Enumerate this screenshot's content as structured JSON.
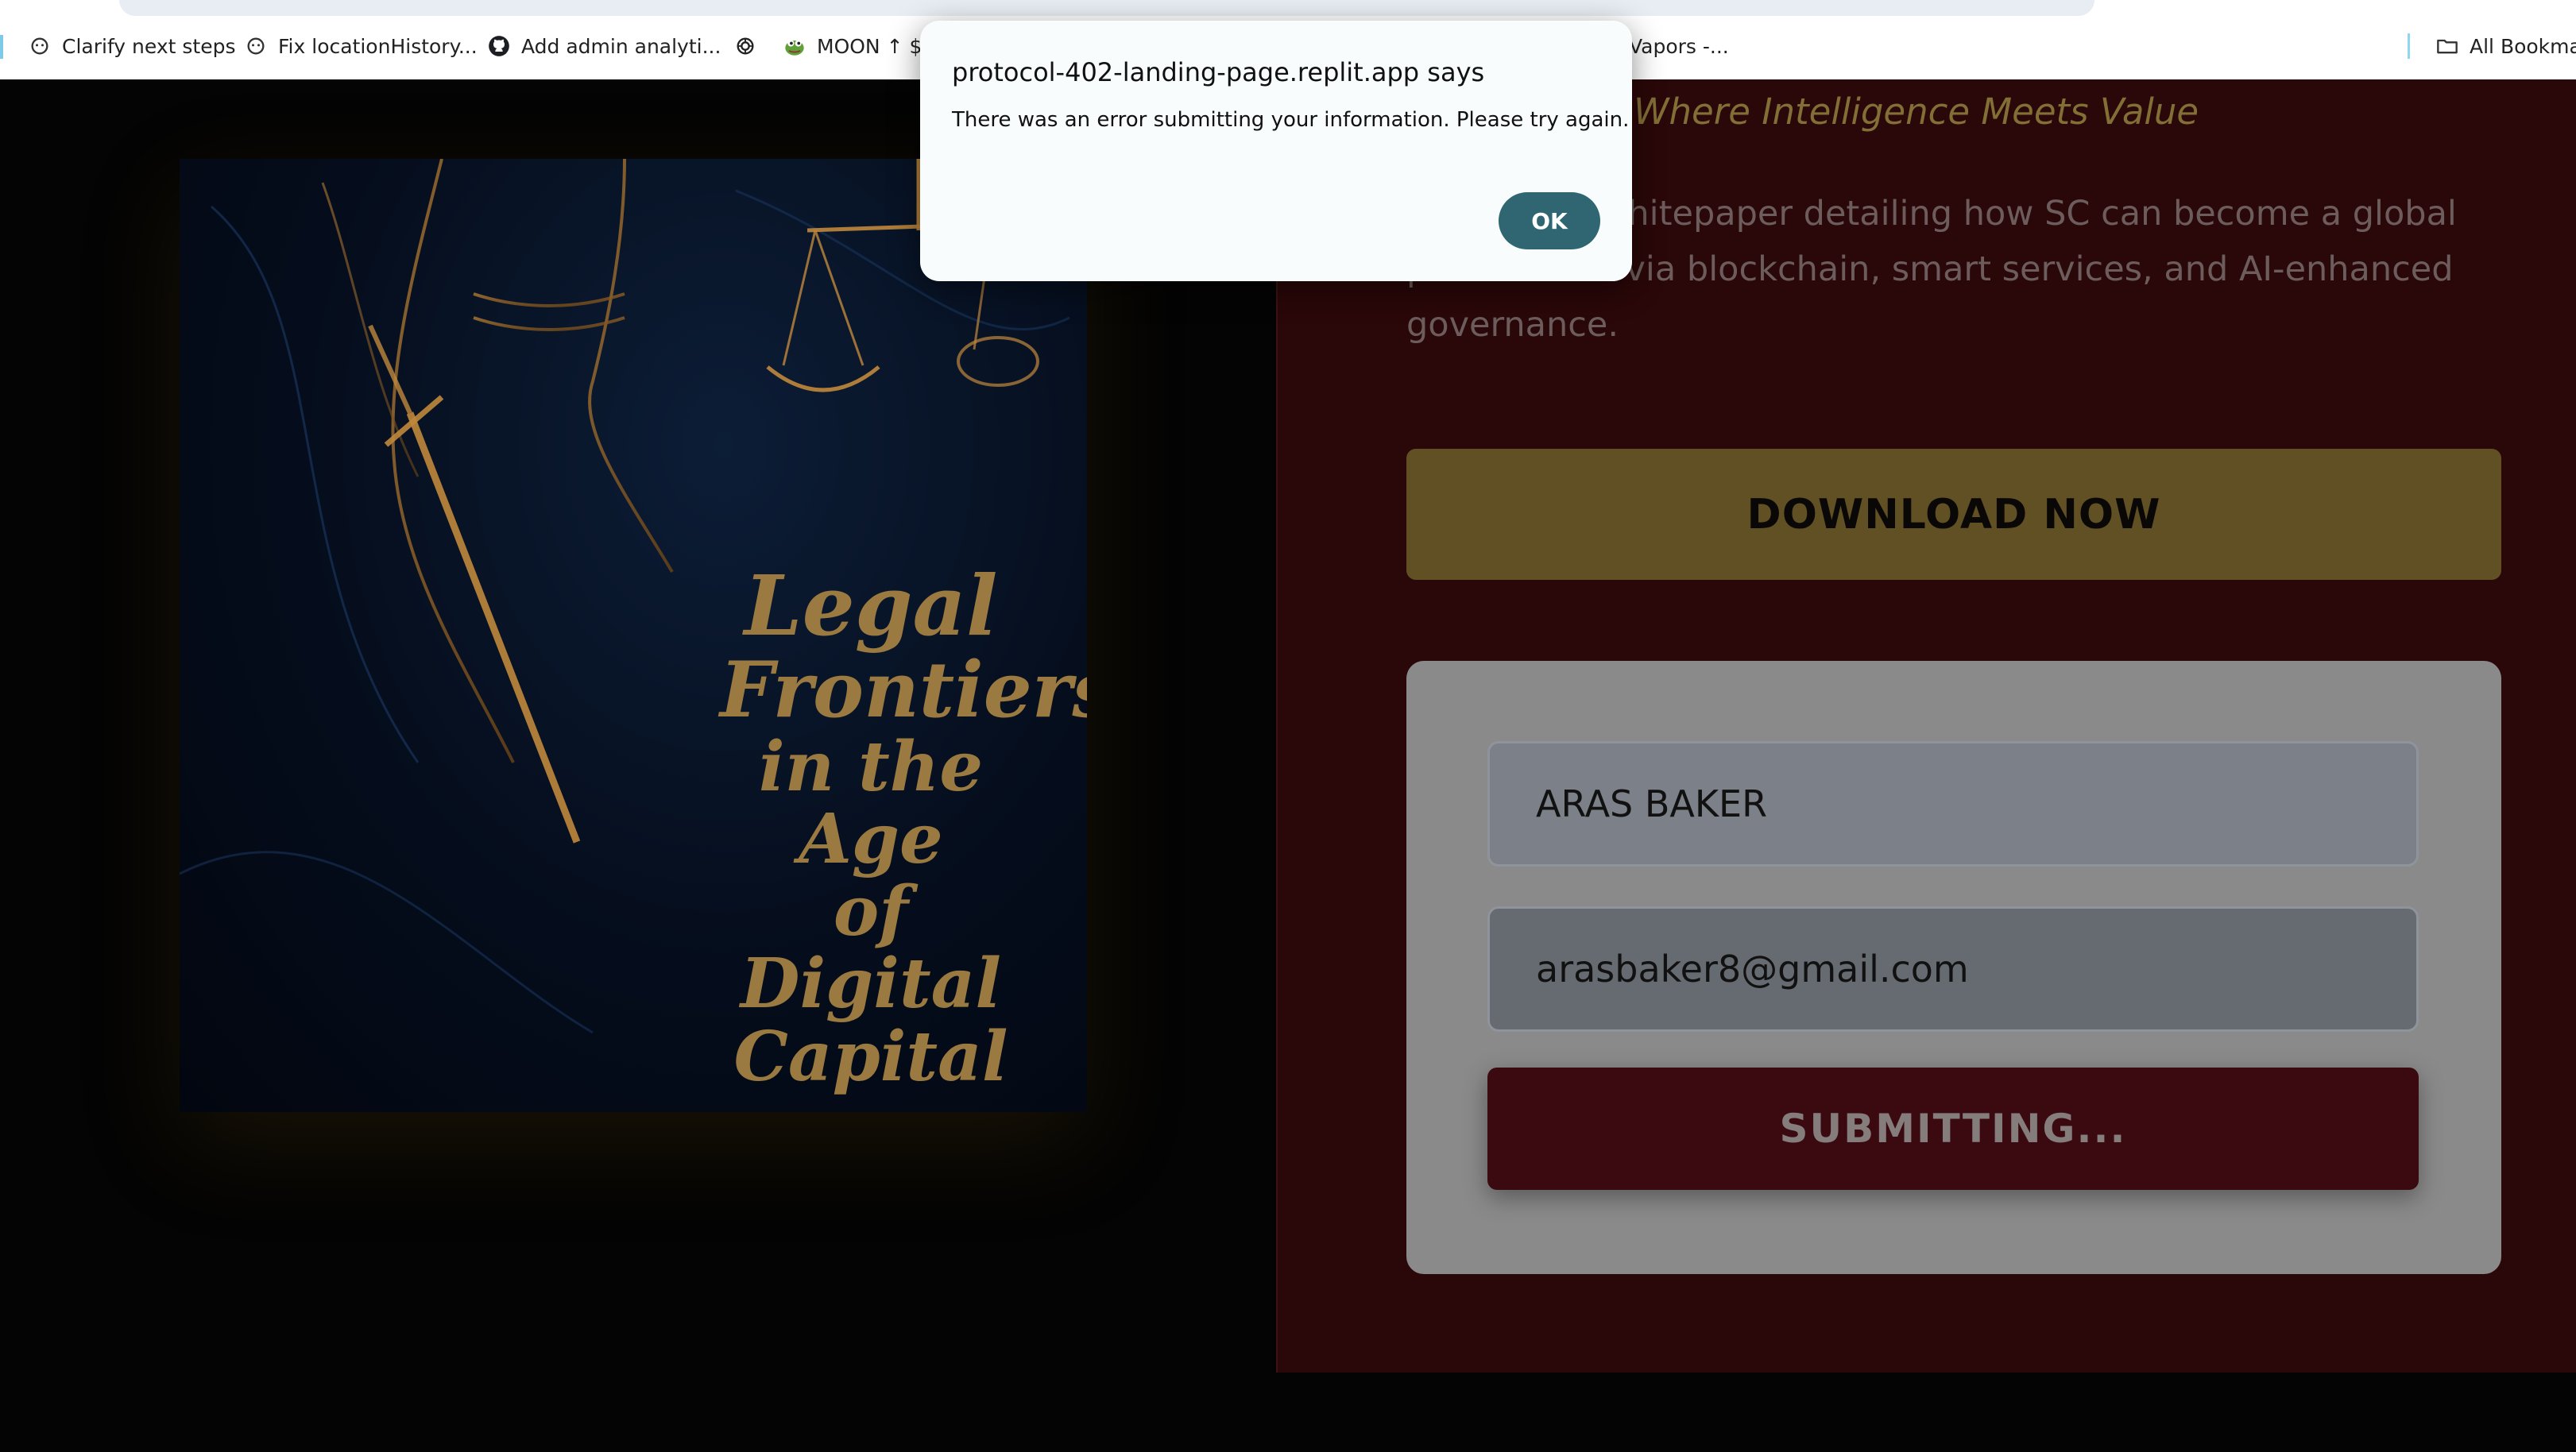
{
  "bookmarks": [
    {
      "label": "Clarify next steps",
      "icon": "chatgpt-chat-icon"
    },
    {
      "label": "Fix locationHistory...",
      "icon": "chatgpt-chat-icon"
    },
    {
      "label": "Add admin analyti...",
      "icon": "github-icon"
    },
    {
      "label": "",
      "icon": "openai-icon"
    },
    {
      "label": "MOON ↑ $(",
      "icon": "pepe-frog-icon"
    },
    {
      "label": "Vapors -...",
      "icon": ""
    },
    {
      "label": "All Bookma",
      "icon": "folder-icon"
    }
  ],
  "cover": {
    "title_lines": [
      "Legal",
      "Frontiers",
      "in the Age",
      "of Digital",
      "Capital"
    ]
  },
  "hero": {
    "tagline": "Where Intelligence Meets Value",
    "description": "al 76-page whitepaper detailing how SC can become a global powerhouse via blockchain, smart services, and AI-enhanced governance."
  },
  "download_button": "DOWNLOAD NOW",
  "form": {
    "name_value": "ARAS BAKER",
    "email_value": "arasbaker8@gmail.com",
    "submit_label": "SUBMITTING..."
  },
  "dialog": {
    "title": "protocol-402-landing-page.replit.app says",
    "message": "There was an error submitting your information. Please try again.",
    "ok_label": "OK"
  },
  "colors": {
    "accent_gold": "#615024",
    "right_panel": "#2a0708",
    "submit_bg": "#3a0a10",
    "ok_button": "#2f6672"
  }
}
